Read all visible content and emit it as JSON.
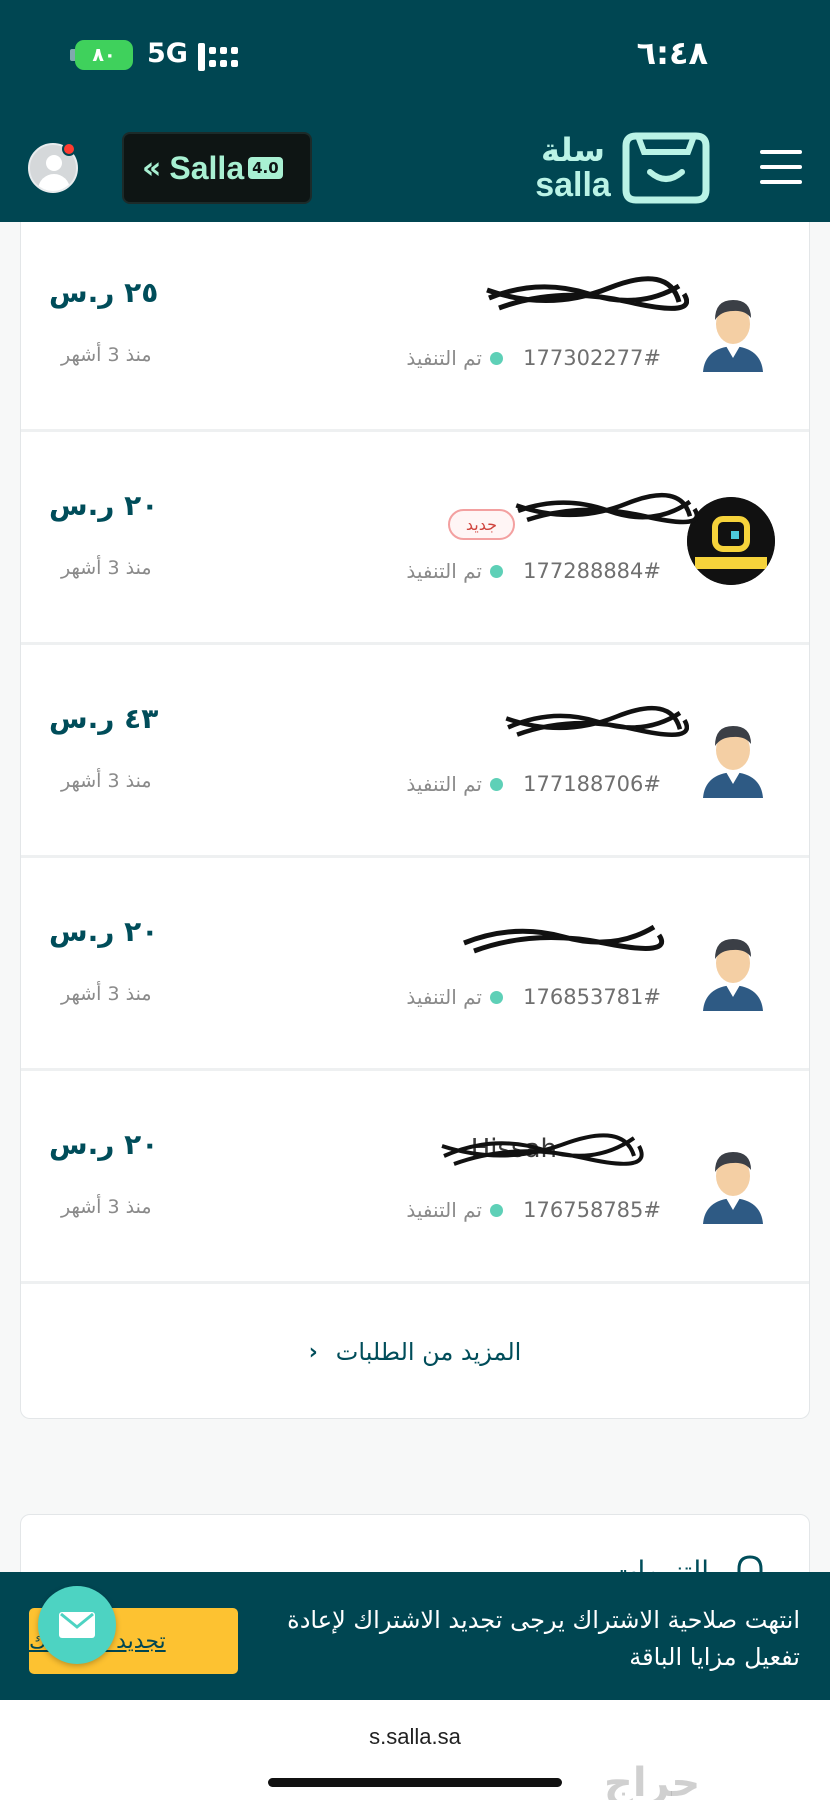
{
  "status_bar": {
    "battery": "٨٠",
    "network": "5G",
    "time": "٦:٤٨"
  },
  "header": {
    "brand_badge": "Salla",
    "brand_version": "4.0",
    "logo_ar": "سلة",
    "logo_en": "salla"
  },
  "orders": [
    {
      "name": "",
      "number": "177302277#",
      "status": "تم التنفيذ",
      "price": "٢٥ ر.س",
      "ago": "منذ 3 أشهر",
      "badge": ""
    },
    {
      "name": "",
      "number": "177288884#",
      "status": "تم التنفيذ",
      "price": "٢٠ ر.س",
      "ago": "منذ 3 أشهر",
      "badge": "جديد"
    },
    {
      "name": "",
      "number": "177188706#",
      "status": "تم التنفيذ",
      "price": "٤٣ ر.س",
      "ago": "منذ 3 أشهر",
      "badge": ""
    },
    {
      "name": "",
      "number": "176853781#",
      "status": "تم التنفيذ",
      "price": "٢٠ ر.س",
      "ago": "منذ 3 أشهر",
      "badge": ""
    },
    {
      "name": "Hissah",
      "number": "176758785#",
      "status": "تم التنفيذ",
      "price": "٢٠ ر.س",
      "ago": "منذ 3 أشهر",
      "badge": ""
    }
  ],
  "more_orders": "المزيد من الطلبات",
  "notifications_title": "التنبيهات",
  "banner": {
    "message": "انتهت صلاحية الاشتراك يرجى تجديد الاشتراك لإعادة تفعيل مزايا الباقة",
    "renew_button": "تجديد الاشتراك"
  },
  "address_bar": {
    "url": "s.salla.sa"
  },
  "watermark": "حراج",
  "colors": {
    "primary": "#004652",
    "accent": "#baf3e6",
    "success_dot": "#5ed0b7",
    "button_yellow": "#fdc231"
  }
}
